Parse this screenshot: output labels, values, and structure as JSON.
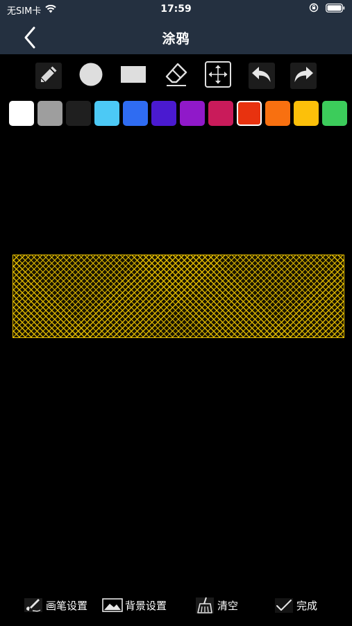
{
  "status_bar": {
    "carrier": "无SIM卡",
    "time": "17:59"
  },
  "nav": {
    "title": "涂鸦",
    "back_icon": "chevron-left-icon"
  },
  "tools": [
    {
      "name": "pencil",
      "icon": "pencil-icon",
      "selected": true
    },
    {
      "name": "circle",
      "icon": "circle-icon",
      "selected": false
    },
    {
      "name": "rectangle",
      "icon": "rectangle-icon",
      "selected": false
    },
    {
      "name": "eraser",
      "icon": "eraser-icon",
      "selected": false
    },
    {
      "name": "move",
      "icon": "move-icon",
      "selected": false
    },
    {
      "name": "undo",
      "icon": "undo-icon",
      "selected": false
    },
    {
      "name": "redo",
      "icon": "redo-icon",
      "selected": false
    }
  ],
  "palette": [
    {
      "color": "#ffffff",
      "selected": false
    },
    {
      "color": "#9e9e9e",
      "selected": false
    },
    {
      "color": "#1f1f1f",
      "selected": false
    },
    {
      "color": "#4cc9f5",
      "selected": false
    },
    {
      "color": "#2f6cf2",
      "selected": false
    },
    {
      "color": "#4a1ad0",
      "selected": false
    },
    {
      "color": "#9019c9",
      "selected": false
    },
    {
      "color": "#c91b5a",
      "selected": false
    },
    {
      "color": "#e8320f",
      "selected": true
    },
    {
      "color": "#f87010",
      "selected": false
    },
    {
      "color": "#fcc00a",
      "selected": false
    },
    {
      "color": "#3ccc5b",
      "selected": false
    }
  ],
  "canvas": {
    "shape": {
      "type": "rectangle",
      "fill": "crosshatch",
      "stroke_color": "#e8c000"
    }
  },
  "bottom_bar": {
    "brush_settings": "画笔设置",
    "background_settings": "背景设置",
    "clear": "清空",
    "done": "完成"
  }
}
